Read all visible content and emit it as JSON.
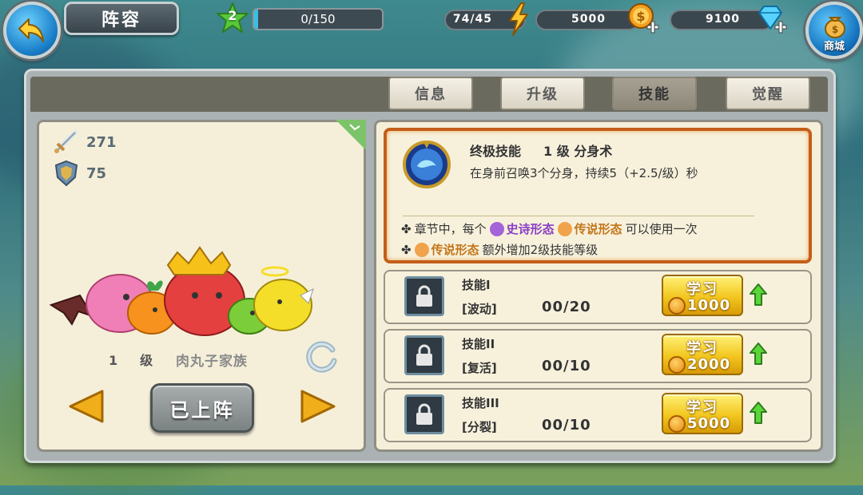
{
  "header": {
    "title": "阵容",
    "player_level": "2",
    "xp_text": "0/150",
    "xp_fraction": 0.03,
    "energy": "74/45",
    "gold": "5000",
    "gems": "9100",
    "shop_label": "商城"
  },
  "tabs": [
    {
      "label": "信息",
      "active": false
    },
    {
      "label": "升级",
      "active": false
    },
    {
      "label": "技能",
      "active": true
    },
    {
      "label": "觉醒",
      "active": false
    }
  ],
  "character": {
    "attack": "271",
    "defense": "75",
    "level_value": "1",
    "level_word": "级",
    "name": "肉丸子家族",
    "deploy_label": "已上阵"
  },
  "ultimate": {
    "type_label": "终极技能",
    "level_text": "1 级 分身术",
    "description": "在身前召唤3个分身，持续5（+2.5/级）秒",
    "note1_prefix": "章节中，每个",
    "note1_tag_epic": "史诗形态",
    "note1_tag_legend": "传说形态",
    "note1_suffix": "可以使用一次",
    "note2_tag_legend": "传说形态",
    "note2_suffix": "额外增加2级技能等级"
  },
  "skills": [
    {
      "name": "技能I",
      "effect": "[波动]",
      "progress": "00/20",
      "learn_label": "学习",
      "cost": "1000"
    },
    {
      "name": "技能II",
      "effect": "[复活]",
      "progress": "00/10",
      "learn_label": "学习",
      "cost": "2000"
    },
    {
      "name": "技能III",
      "effect": "[分裂]",
      "progress": "00/10",
      "learn_label": "学习",
      "cost": "5000"
    }
  ],
  "colors": {
    "accent_orange": "#c45e1a",
    "learn_button": "#f2c61f",
    "epic_purple": "#8a3fc4",
    "legend_orange": "#c3761a"
  }
}
